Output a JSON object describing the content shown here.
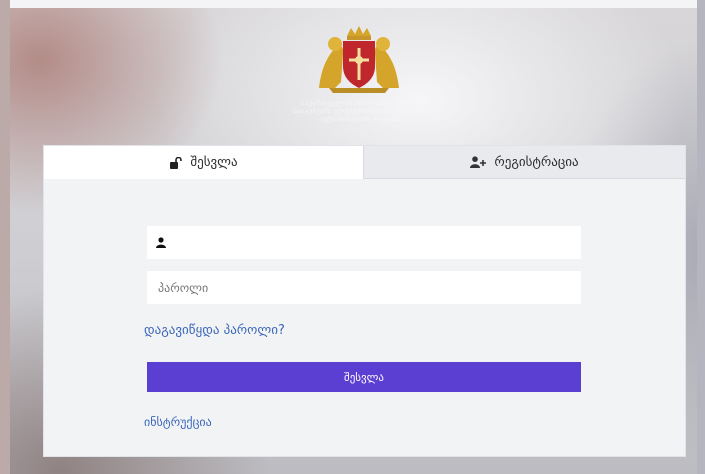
{
  "colors": {
    "accent": "#5b3fd3",
    "link": "#3a67b8",
    "card_bg": "#f2f3f5",
    "coat_red": "#c0272d",
    "coat_gold": "#d4a52a"
  },
  "header": {
    "emblem": "georgian-coat-of-arms-icon",
    "lines": [
      "საქართველოს შსს მომსახურების",
      "სააგენტოს ელექტრონული სერვისები",
      "ავტორიზაციის სისტემა"
    ]
  },
  "tabs": [
    {
      "label": "შესვლა",
      "icon": "unlock-icon",
      "active": true
    },
    {
      "label": "რეგისტრაცია",
      "icon": "user-plus-icon",
      "active": false
    }
  ],
  "form": {
    "username": {
      "value": "",
      "placeholder": "",
      "icon": "user-icon"
    },
    "password": {
      "value": "",
      "placeholder": "პაროლი"
    },
    "forgot_password": "დაგავიწყდა პაროლი?",
    "submit_label": "შესვლა",
    "instruction_link": "ინსტრუქცია"
  }
}
